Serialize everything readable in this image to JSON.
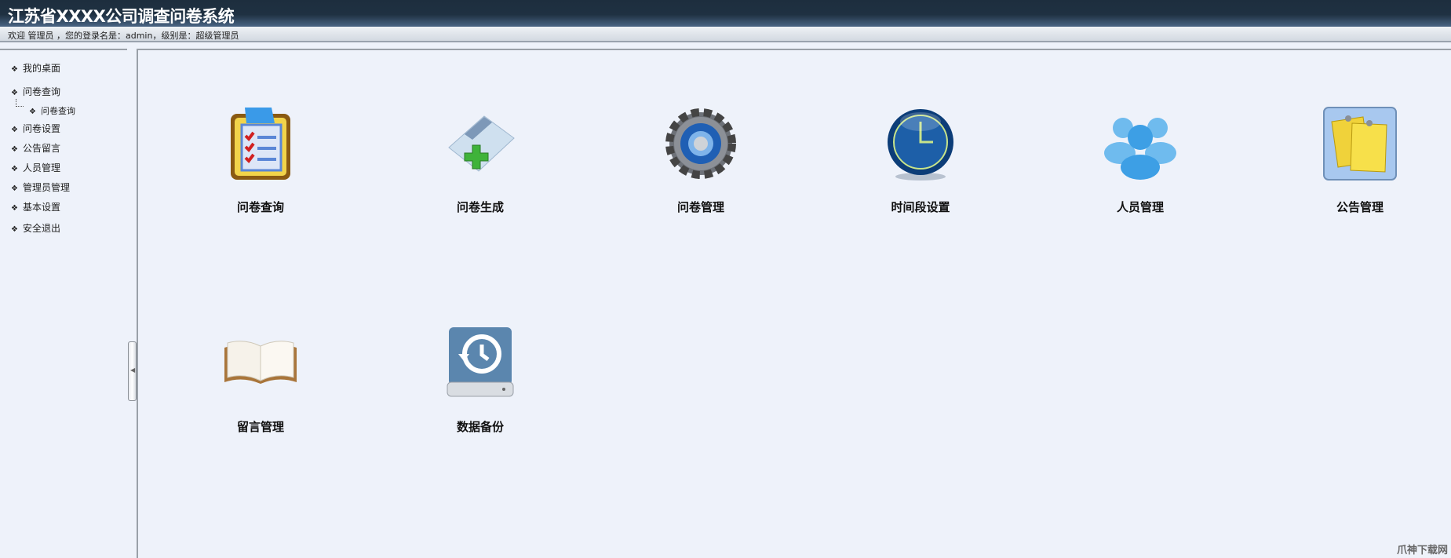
{
  "header": {
    "title": "江苏省XXXX公司调查问卷系统",
    "welcome": "欢迎 管理员 ，您的登录名是：admin，级别是：超级管理员"
  },
  "sidebar": {
    "items": [
      {
        "label": "我的桌面"
      },
      {
        "label": "问卷查询"
      },
      {
        "label": "问卷查询"
      },
      {
        "label": "问卷设置"
      },
      {
        "label": "公告留言"
      },
      {
        "label": "人员管理"
      },
      {
        "label": "管理员管理"
      },
      {
        "label": "基本设置"
      },
      {
        "label": "安全退出"
      }
    ],
    "bullet": "❖",
    "collapse": "◀"
  },
  "tiles": [
    {
      "label": "问卷查询",
      "icon": "clipboard-icon"
    },
    {
      "label": "问卷生成",
      "icon": "notepad-add-icon"
    },
    {
      "label": "问卷管理",
      "icon": "gear-icon"
    },
    {
      "label": "时间段设置",
      "icon": "clock-icon"
    },
    {
      "label": "人员管理",
      "icon": "users-icon"
    },
    {
      "label": "公告管理",
      "icon": "sticky-notes-icon"
    },
    {
      "label": "留言管理",
      "icon": "book-icon"
    },
    {
      "label": "数据备份",
      "icon": "backup-drive-icon"
    }
  ],
  "watermark": "爪神下载网"
}
